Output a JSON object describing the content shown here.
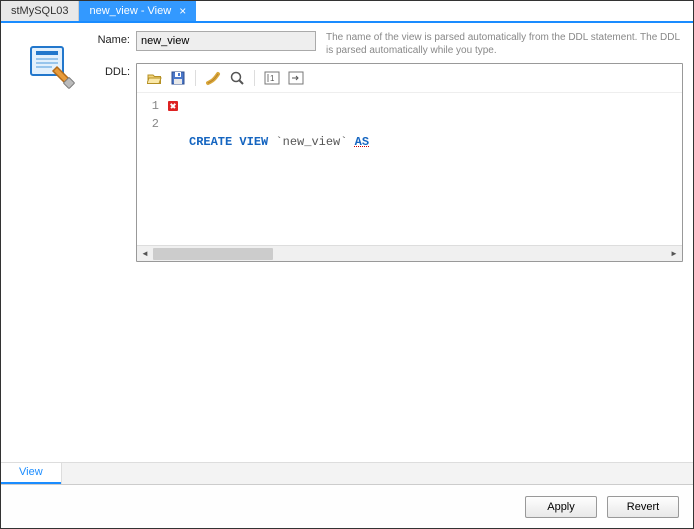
{
  "tabs": [
    {
      "label": "stMySQL03",
      "active": false
    },
    {
      "label": "new_view - View",
      "active": true
    }
  ],
  "form": {
    "name_label": "Name:",
    "name_value": "new_view",
    "ddl_label": "DDL:",
    "hint": "The name of the view is parsed automatically from the DDL statement. The DDL is parsed automatically while you type."
  },
  "toolbar": {
    "open": "Open",
    "save": "Save",
    "format": "Beautify",
    "search": "Find",
    "wrap": "Toggle Wrap",
    "invisible": "Show Invisible"
  },
  "editor": {
    "lines": [
      {
        "n": "1",
        "error": true,
        "tokens": [
          "CREATE",
          " ",
          "VIEW",
          " ",
          "`new_view`",
          " ",
          "AS"
        ]
      },
      {
        "n": "2",
        "error": false,
        "tokens": []
      }
    ]
  },
  "bottom_tab": "View",
  "buttons": {
    "apply": "Apply",
    "revert": "Revert"
  }
}
